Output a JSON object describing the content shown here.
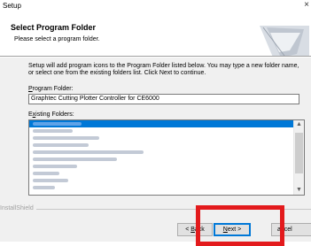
{
  "window": {
    "title": "Setup",
    "close_label": "×"
  },
  "header": {
    "title": "Select Program Folder",
    "subtitle": "Please select a program folder."
  },
  "body": {
    "description": "Setup will add program icons to the Program Folder listed below.  You may type a new folder name, or select one from the existing folders list.  Click Next to continue.",
    "program_folder_label_access": "P",
    "program_folder_label_rest": "rogram Folder:",
    "program_folder_value": "Graphtec Cutting Plotter Controller for CE6000",
    "existing_folders_label_pre": "E",
    "existing_folders_label_access": "x",
    "existing_folders_label_rest": "isting Folders:",
    "existing_folders": [
      {
        "selected": true,
        "blur": 0.22
      },
      {
        "selected": false,
        "blur": 0.18
      },
      {
        "selected": false,
        "blur": 0.3
      },
      {
        "selected": false,
        "blur": 0.25
      },
      {
        "selected": false,
        "blur": 0.5
      },
      {
        "selected": false,
        "blur": 0.38
      },
      {
        "selected": false,
        "blur": 0.2
      },
      {
        "selected": false,
        "blur": 0.12
      },
      {
        "selected": false,
        "blur": 0.16
      },
      {
        "selected": false,
        "blur": 0.1
      }
    ]
  },
  "footer": {
    "brand": "InstallShield",
    "back_pre": "< ",
    "back_access": "B",
    "back_rest": "ack",
    "next_access": "N",
    "next_rest": "ext >",
    "cancel_label": "ancel"
  },
  "colors": {
    "selection": "#0078d7",
    "highlight": "#e31a1c"
  }
}
